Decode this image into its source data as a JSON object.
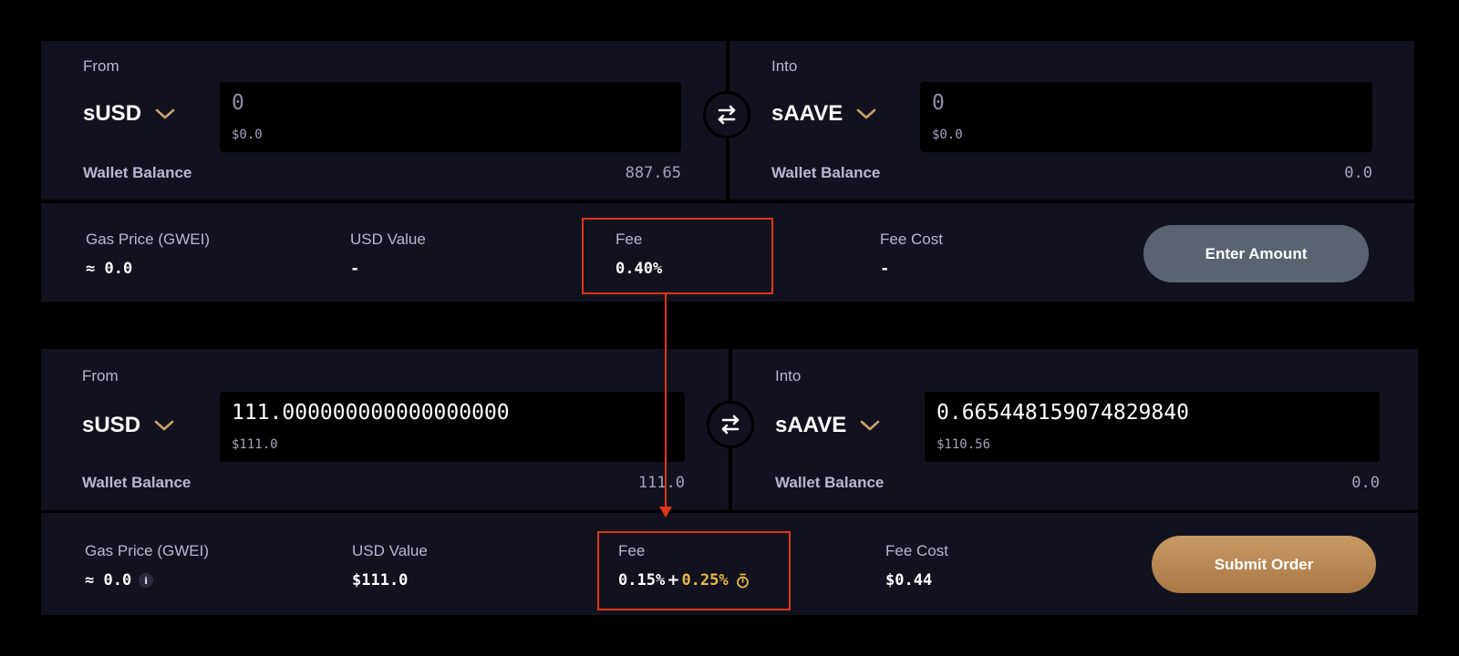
{
  "top": {
    "from": {
      "label": "From",
      "token": "sUSD",
      "amount": "0",
      "usd": "$0.0",
      "wallet_label": "Wallet Balance",
      "wallet_value": "887.65"
    },
    "into": {
      "label": "Into",
      "token": "sAAVE",
      "amount": "0",
      "usd": "$0.0",
      "wallet_label": "Wallet Balance",
      "wallet_value": "0.0"
    },
    "stats": {
      "gas_label": "Gas Price (GWEI)",
      "gas_value": "≈ 0.0",
      "usd_label": "USD Value",
      "usd_value": "-",
      "fee_label": "Fee",
      "fee_value": "0.40%",
      "fee_cost_label": "Fee Cost",
      "fee_cost_value": "-"
    },
    "button": "Enter Amount"
  },
  "bottom": {
    "from": {
      "label": "From",
      "token": "sUSD",
      "amount": "111.000000000000000000",
      "usd": "$111.0",
      "wallet_label": "Wallet Balance",
      "wallet_value": "111.0"
    },
    "into": {
      "label": "Into",
      "token": "sAAVE",
      "amount": "0.665448159074829840",
      "usd": "$110.56",
      "wallet_label": "Wallet Balance",
      "wallet_value": "0.0"
    },
    "stats": {
      "gas_label": "Gas Price (GWEI)",
      "gas_value": "≈ 0.0",
      "info_glyph": "i",
      "usd_label": "USD Value",
      "usd_value": "$111.0",
      "fee_label": "Fee",
      "fee_base": "0.15%",
      "fee_plus": "+",
      "fee_extra": "0.25%",
      "fee_cost_label": "Fee Cost",
      "fee_cost_value": "$0.44"
    },
    "button": "Submit Order"
  },
  "icons": {
    "swap": "swap-arrows-icon",
    "chevron": "chevron-down-icon",
    "info": "info-icon",
    "timer": "stopwatch-icon"
  },
  "colors": {
    "background": "#000000",
    "panel": "#12121f",
    "chevron": "#c9a26e",
    "highlight": "#e0341b",
    "fee_extra": "#e8b84a",
    "button_disabled": "#5b6370",
    "button_submit": "#b8895a"
  }
}
